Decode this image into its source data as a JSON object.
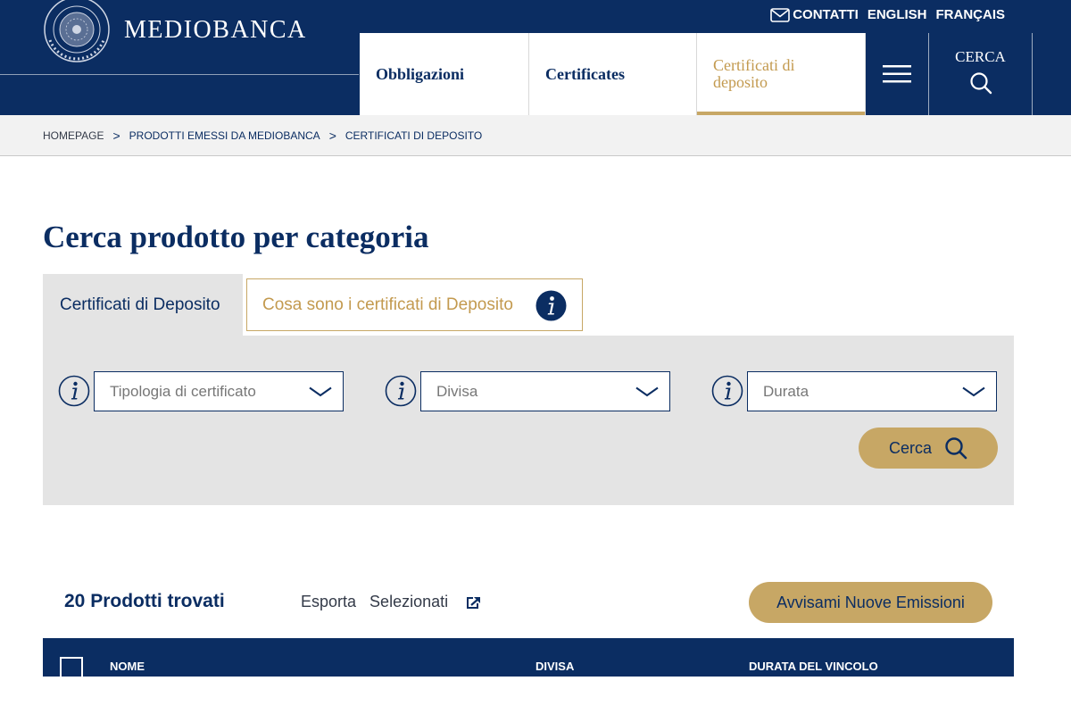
{
  "brand": {
    "name": "MEDIOBANCA",
    "seal_text": "MEDIOBANCA · BANCA DI CREDITO FINANZIARIO"
  },
  "top_links": [
    "CONTATTI",
    "ENGLISH",
    "FRANÇAIS"
  ],
  "nav": {
    "tabs": [
      {
        "label": "Obbligazioni",
        "active": false
      },
      {
        "label": "Certificates",
        "active": false
      },
      {
        "label": "Certificati di deposito",
        "active": true
      }
    ],
    "search_label": "CERCA"
  },
  "breadcrumb": [
    "HOMEPAGE",
    "PRODOTTI EMESSI DA MEDIOBANCA",
    "CERTIFICATI DI DEPOSITO"
  ],
  "breadcrumb_separator": ">",
  "page_title": "Cerca prodotto per categoria",
  "category_tabs": {
    "main": "Certificati di Deposito",
    "info": "Cosa sono i certificati di Deposito"
  },
  "filters": [
    {
      "placeholder": "Tipologia di certificato"
    },
    {
      "placeholder": "Divisa"
    },
    {
      "placeholder": "Durata"
    }
  ],
  "search_button": "Cerca",
  "results": {
    "count_label": "20 Prodotti trovati",
    "export_label": "Esporta",
    "selected_label": "Selezionati",
    "notify_button": "Avvisami Nuove Emissioni"
  },
  "table": {
    "columns": [
      "NOME",
      "DIVISA",
      "DURATA DEL VINCOLO"
    ]
  },
  "colors": {
    "navy": "#0b2d62",
    "gold": "#c7a765",
    "panel_gray": "#e4e4e4"
  }
}
